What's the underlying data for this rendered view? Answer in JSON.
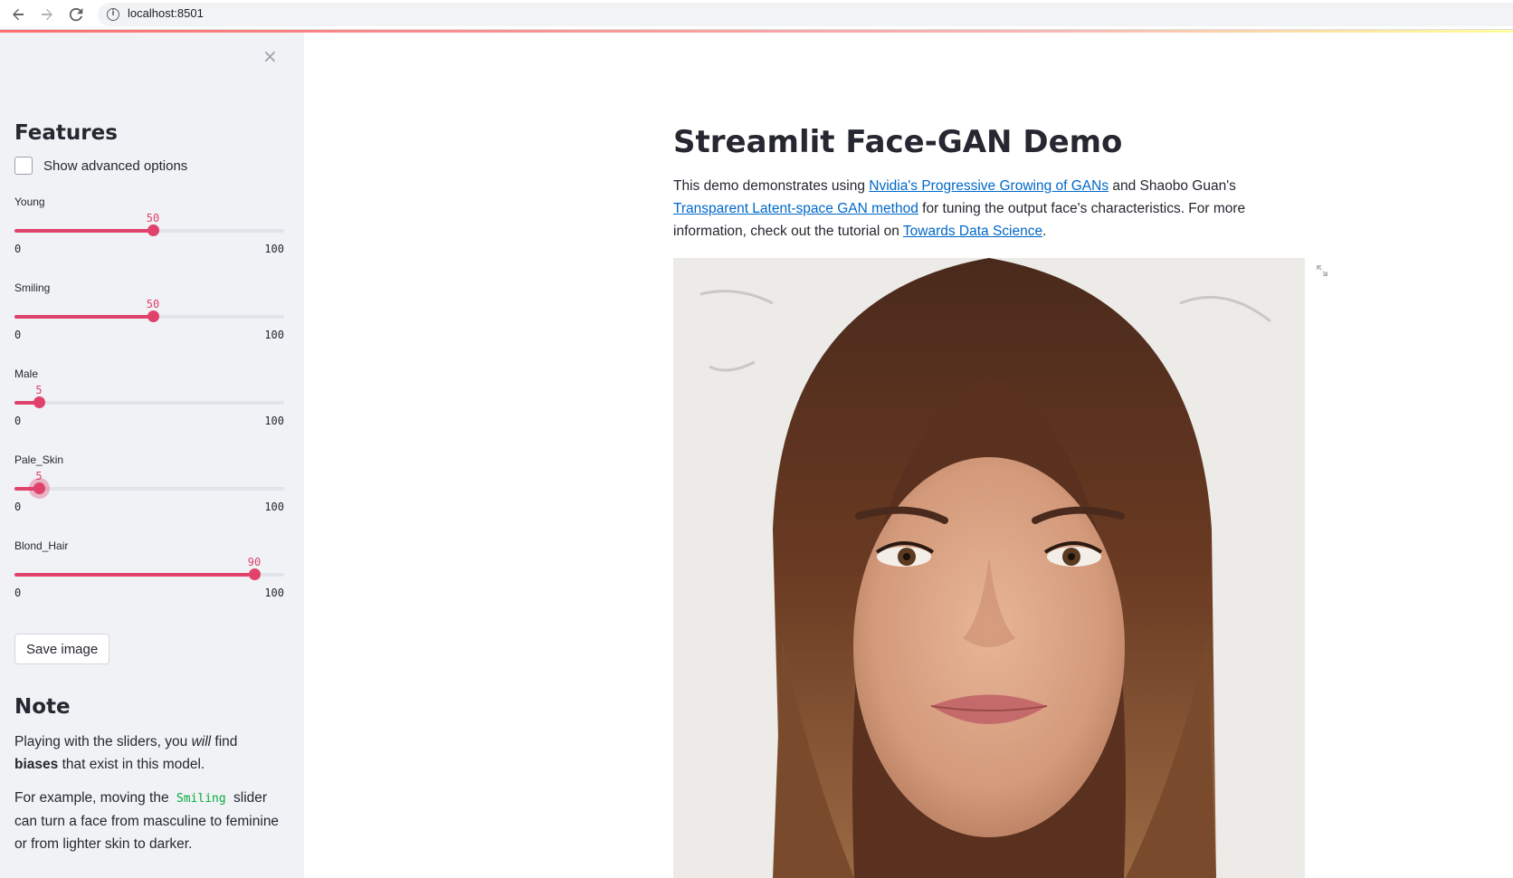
{
  "browser": {
    "back_icon": "back-arrow-icon",
    "forward_icon": "forward-arrow-icon",
    "reload_icon": "reload-icon",
    "url": "localhost:8501"
  },
  "sidebar": {
    "close_label": "×",
    "features_heading": "Features",
    "advanced_checkbox": {
      "label": "Show advanced options",
      "checked": false
    },
    "sliders": [
      {
        "label": "Young",
        "value": 50,
        "value_text": "50",
        "min": 0,
        "max": 100,
        "min_text": "0",
        "max_text": "100"
      },
      {
        "label": "Smiling",
        "value": 50,
        "value_text": "50",
        "min": 0,
        "max": 100,
        "min_text": "0",
        "max_text": "100"
      },
      {
        "label": "Male",
        "value": 5,
        "value_text": "5",
        "min": 0,
        "max": 100,
        "min_text": "0",
        "max_text": "100"
      },
      {
        "label": "Pale_Skin",
        "value": 5,
        "value_text": "5",
        "min": 0,
        "max": 100,
        "min_text": "0",
        "max_text": "100"
      },
      {
        "label": "Blond_Hair",
        "value": 90,
        "value_text": "90",
        "min": 0,
        "max": 100,
        "min_text": "0",
        "max_text": "100"
      }
    ],
    "save_button": "Save image",
    "note_heading": "Note",
    "note_p1": {
      "t1": "Playing with the sliders, you ",
      "em": "will",
      "t2": " find ",
      "strong": "biases",
      "t3": " that exist in this model."
    },
    "note_p2": {
      "t1": "For example, moving the ",
      "code": "Smiling",
      "t2": " slider can turn a face from masculine to feminine or from lighter skin to darker."
    }
  },
  "main": {
    "title": "Streamlit Face-GAN Demo",
    "intro": {
      "t1": "This demo demonstrates using ",
      "link1": "Nvidia's Progressive Growing of GANs",
      "t2": " and Shaobo Guan's ",
      "link2": "Transparent Latent-space GAN method",
      "t3": " for tuning the output face's characteristics. For more information, check out the tutorial on ",
      "link3": "Towards Data Science",
      "t4": "."
    },
    "image_description_icon": "generated-face-image",
    "expand_icon": "fullscreen-expand-icon"
  },
  "colors": {
    "accent": "#e0426b",
    "link": "#0068c9",
    "sidebar_bg": "#f0f2f6",
    "text": "#262730"
  }
}
